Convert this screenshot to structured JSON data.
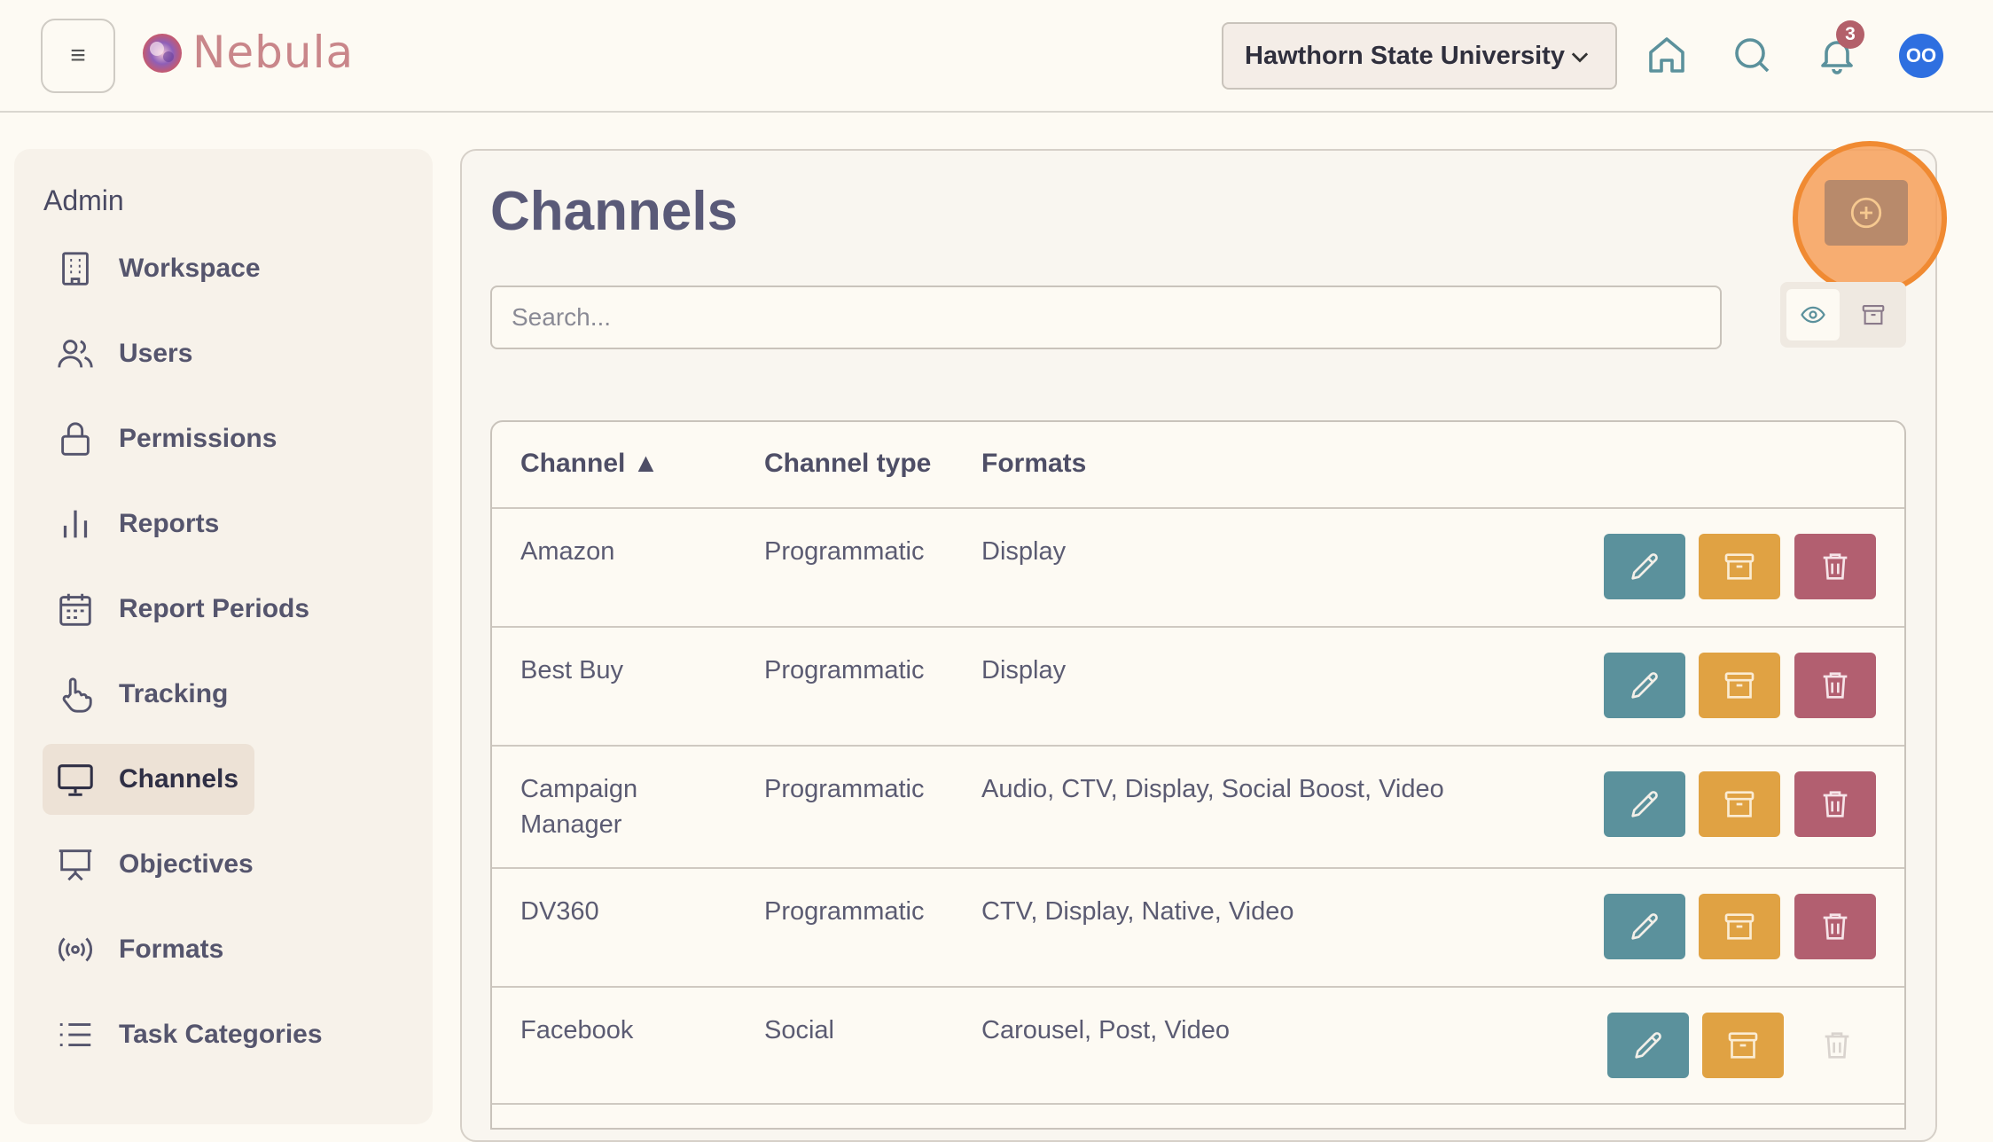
{
  "header": {
    "brand": "Nebula",
    "org_select": "Hawthorn State University",
    "notification_count": "3",
    "avatar_initials": "OO"
  },
  "sidebar": {
    "heading": "Admin",
    "items": [
      {
        "label": "Workspace",
        "icon": "building-icon"
      },
      {
        "label": "Users",
        "icon": "users-icon"
      },
      {
        "label": "Permissions",
        "icon": "lock-icon"
      },
      {
        "label": "Reports",
        "icon": "bar-chart-icon"
      },
      {
        "label": "Report Periods",
        "icon": "calendar-icon"
      },
      {
        "label": "Tracking",
        "icon": "pointer-hand-icon"
      },
      {
        "label": "Channels",
        "icon": "monitor-icon",
        "active": true
      },
      {
        "label": "Objectives",
        "icon": "presentation-icon"
      },
      {
        "label": "Formats",
        "icon": "broadcast-icon"
      },
      {
        "label": "Task Categories",
        "icon": "list-icon"
      }
    ]
  },
  "main": {
    "title": "Channels",
    "search_placeholder": "Search...",
    "columns": [
      "Channel ▲",
      "Channel type",
      "Formats"
    ],
    "rows": [
      {
        "channel": "Amazon",
        "type": "Programmatic",
        "formats": "Display",
        "can_delete": true
      },
      {
        "channel": "Best Buy",
        "type": "Programmatic",
        "formats": "Display",
        "can_delete": true
      },
      {
        "channel": "Campaign Manager",
        "type": "Programmatic",
        "formats": "Audio, CTV, Display, Social Boost, Video",
        "can_delete": true
      },
      {
        "channel": "DV360",
        "type": "Programmatic",
        "formats": "CTV, Display, Native, Video",
        "can_delete": true
      },
      {
        "channel": "Facebook",
        "type": "Social",
        "formats": "Carousel, Post, Video",
        "can_delete": false
      }
    ]
  },
  "colors": {
    "edit": "#5b919c",
    "archive": "#e0a243",
    "delete": "#b25f70",
    "highlight": "#f08a32"
  }
}
